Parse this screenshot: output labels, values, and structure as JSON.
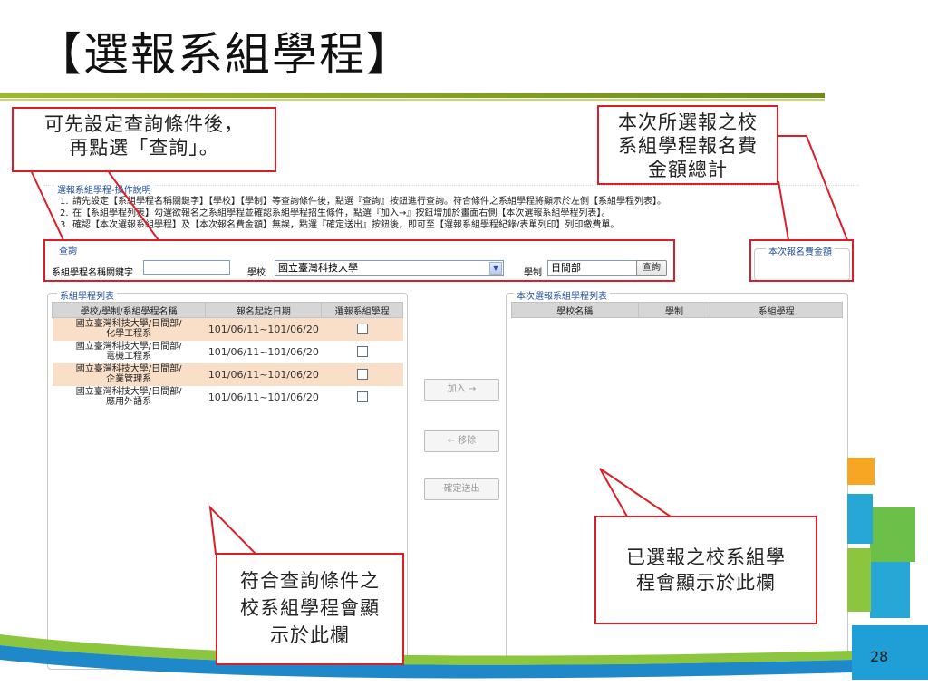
{
  "slide": {
    "title": "【選報系組學程】",
    "page_number": "28"
  },
  "callouts": {
    "query_hint": [
      "可先設定查詢條件後，",
      "再點選「查詢」。"
    ],
    "fee_hint": [
      "本次所選報之校",
      "系組學程報名費",
      "金額總計"
    ],
    "list_hint": [
      "符合查詢條件之",
      "校系組學程會顯",
      "示於此欄"
    ],
    "selected_hint": [
      "已選報之校系組學",
      "程會顯示於此欄"
    ]
  },
  "instructions": {
    "legend": "選報系組學程-操作說明",
    "steps": [
      {
        "num": "1.",
        "text": "請先設定【系組學程名稱關鍵字】【學校】【學制】等查詢條件後，點選『查詢』按鈕進行查詢。符合條件之系組學程將顯示於左側【系組學程列表】。"
      },
      {
        "num": "2.",
        "text": "在【系組學程列表】勾選欲報名之系組學程並確認系組學程招生條件，點選『加入→』按鈕增加於畫面右側【本次選報系組學程列表】。"
      },
      {
        "num": "3.",
        "text": "確認【本次選報系組學程】及【本次報名費金額】無誤，點選『確定送出』按鈕後，即可至【選報系組學程紀錄/表單列印】列印繳費單。"
      }
    ]
  },
  "query": {
    "legend": "查詢",
    "keyword_label": "系組學程名稱關鍵字",
    "keyword_value": "",
    "school_label": "學校",
    "school_value": "國立臺灣科技大學",
    "system_label": "學制",
    "system_value": "日間部",
    "search_button": "查詢"
  },
  "fee_panel": {
    "legend": "本次報名費金額",
    "amount": ""
  },
  "dept_list": {
    "legend": "系組學程列表",
    "columns": [
      "學校/學制/系組學程名稱",
      "報名起訖日期",
      "選報系組學程"
    ],
    "rows": [
      {
        "name1": "國立臺灣科技大學/日間部/",
        "name2": "化學工程系",
        "dates": "101/06/11~101/06/20",
        "checked": false
      },
      {
        "name1": "國立臺灣科技大學/日間部/",
        "name2": "電機工程系",
        "dates": "101/06/11~101/06/20",
        "checked": false
      },
      {
        "name1": "國立臺灣科技大學/日間部/",
        "name2": "企業管理系",
        "dates": "101/06/11~101/06/20",
        "checked": false
      },
      {
        "name1": "國立臺灣科技大學/日間部/",
        "name2": "應用外語系",
        "dates": "101/06/11~101/06/20",
        "checked": false
      }
    ]
  },
  "actions": {
    "add": "加入 →",
    "remove": "← 移除",
    "submit": "確定送出"
  },
  "selected_list": {
    "legend": "本次選報系組學程列表",
    "columns": [
      "學校名稱",
      "學制",
      "系組學程"
    ]
  },
  "colors": {
    "accent_red": "#d9202a",
    "legend_blue": "#1f4e9c",
    "row_highlight": "#f9dfc8",
    "title_rule_green": "#9bbb2a"
  }
}
